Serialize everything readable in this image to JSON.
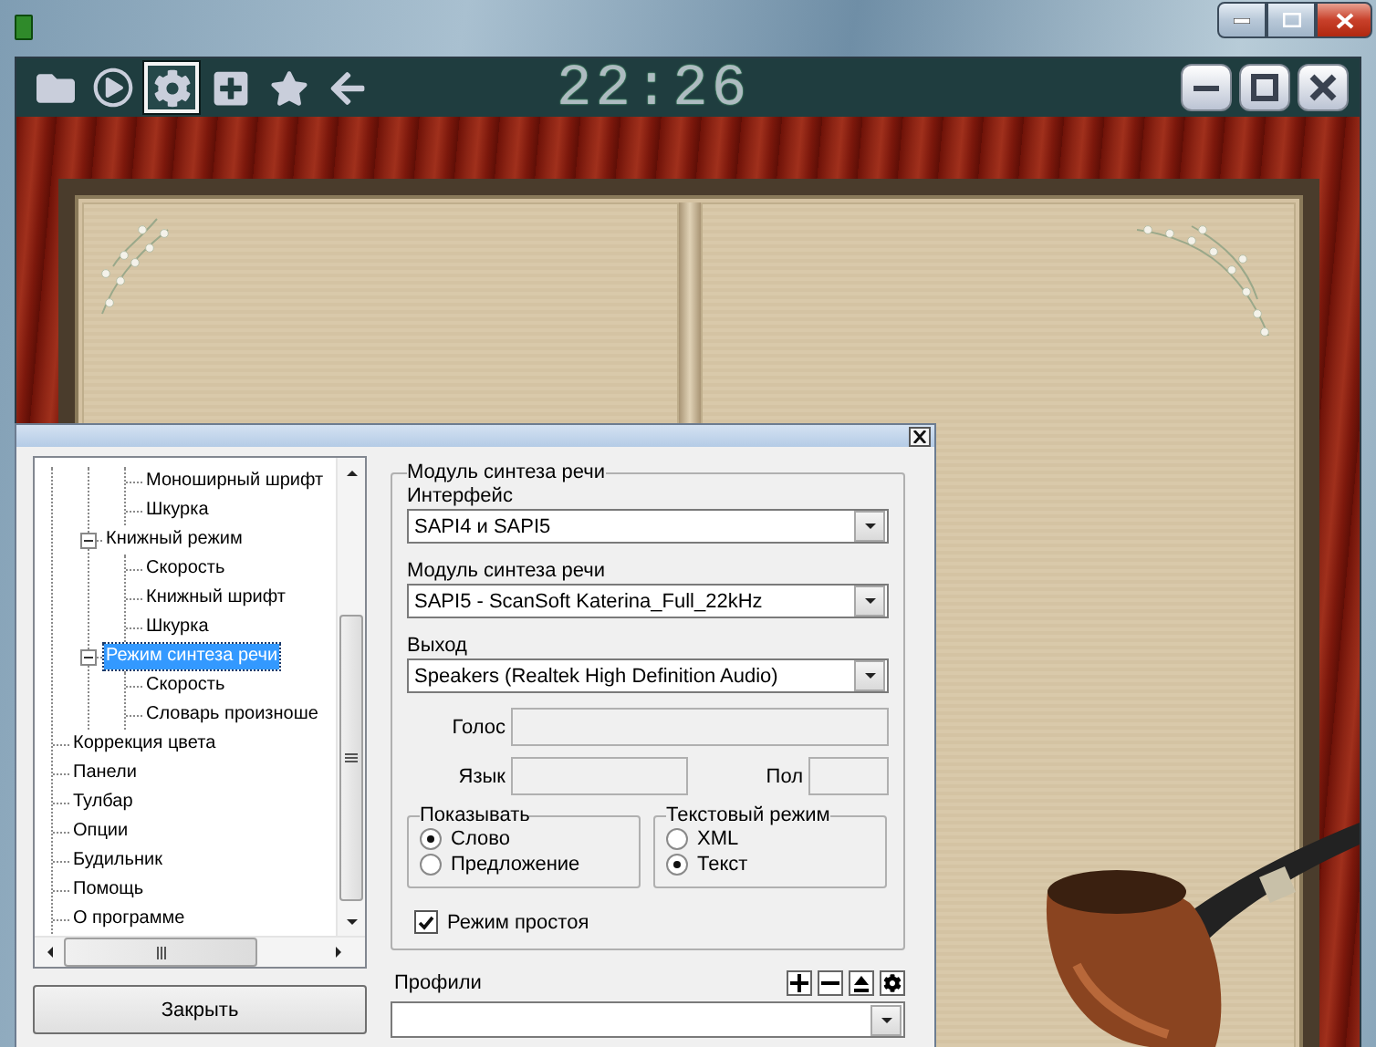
{
  "toolbar": {
    "buttons": [
      {
        "kind": "folder",
        "selected": false
      },
      {
        "kind": "play",
        "selected": false
      },
      {
        "kind": "settings",
        "selected": true
      },
      {
        "kind": "add",
        "selected": false
      },
      {
        "kind": "star",
        "selected": false
      },
      {
        "kind": "back",
        "selected": false
      }
    ],
    "clock": "22:26"
  },
  "dialog": {
    "tree": {
      "items": [
        {
          "children": [
            {
              "children": [
                {
                  "label": "Моноширный шрифт",
                  "selected": false
                },
                {
                  "label": "Шкурка",
                  "selected": false
                }
              ]
            },
            {
              "label": "Книжный режим",
              "expanded": true,
              "selected": false,
              "children": [
                {
                  "label": "Скорость",
                  "selected": false
                },
                {
                  "label": "Книжный шрифт",
                  "selected": false
                },
                {
                  "label": "Шкурка",
                  "selected": false
                }
              ]
            },
            {
              "label": "Режим синтеза речи",
              "expanded": true,
              "selected": true,
              "children": [
                {
                  "label": "Скорость",
                  "selected": false
                },
                {
                  "label": "Словарь произноше",
                  "selected": false
                }
              ]
            }
          ]
        },
        {
          "label": "Коррекция цвета",
          "selected": false
        },
        {
          "label": "Панели",
          "selected": false
        },
        {
          "label": "Тулбар",
          "selected": false
        },
        {
          "label": "Опции",
          "selected": false
        },
        {
          "label": "Будильник",
          "selected": false
        },
        {
          "label": "Помощь",
          "selected": false
        },
        {
          "label": "О программе",
          "selected": false
        }
      ]
    },
    "close_button": "Закрыть",
    "synth_group": {
      "title": "Модуль синтеза речи",
      "interface": {
        "label": "Интерфейс",
        "value": "SAPI4 и SAPI5"
      },
      "engine": {
        "label": "Модуль синтеза речи",
        "value": "SAPI5 - ScanSoft Katerina_Full_22kHz"
      },
      "output": {
        "label": "Выход",
        "value": "Speakers (Realtek High Definition Audio)"
      },
      "voice": {
        "label": "Голос",
        "disabled": true
      },
      "language": {
        "label": "Язык",
        "disabled": true
      },
      "gender": {
        "label": "Пол",
        "disabled": true
      },
      "show": {
        "title": "Показывать",
        "options": [
          {
            "label": "Слово",
            "selected": true
          },
          {
            "label": "Предложение",
            "selected": false
          }
        ]
      },
      "text_mode": {
        "title": "Текстовый режим",
        "options": [
          {
            "label": "XML",
            "selected": false
          },
          {
            "label": "Текст",
            "selected": true
          }
        ]
      },
      "idle_mode": {
        "label": "Режим простоя",
        "checked": true
      }
    },
    "profiles": {
      "label": "Профили",
      "buttons": [
        {
          "kind": "add"
        },
        {
          "kind": "remove"
        },
        {
          "kind": "upload"
        },
        {
          "kind": "settings"
        }
      ]
    }
  }
}
